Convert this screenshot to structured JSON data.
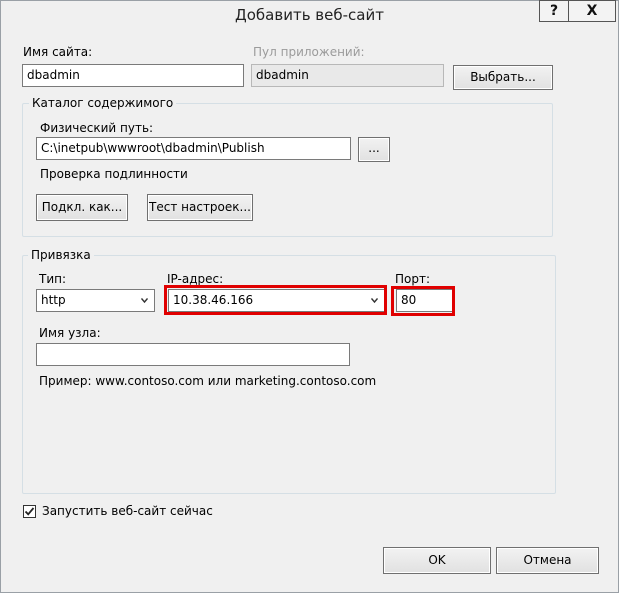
{
  "window": {
    "title": "Добавить веб-сайт",
    "help_label": "?",
    "close_label": "X"
  },
  "site": {
    "name_label": "Имя сайта:",
    "name_value": "dbadmin"
  },
  "app_pool": {
    "label": "Пул приложений:",
    "value": "dbadmin",
    "select_button": "Выбрать..."
  },
  "content": {
    "group_title": "Каталог содержимого",
    "path_label": "Физический путь:",
    "path_value": "C:\\inetpub\\wwwroot\\dbadmin\\Publish",
    "browse_button": "...",
    "auth_label": "Проверка подлинности",
    "connect_as_button": "Подкл. как...",
    "test_settings_button": "Тест настроек..."
  },
  "binding": {
    "group_title": "Привязка",
    "type_label": "Тип:",
    "type_value": "http",
    "ip_label": "IP-адрес:",
    "ip_value": "10.38.46.166",
    "port_label": "Порт:",
    "port_value": "80",
    "host_label": "Имя узла:",
    "host_value": "",
    "example_text": "Пример: www.contoso.com или marketing.contoso.com"
  },
  "start_site": {
    "label": "Запустить веб-сайт сейчас",
    "checked": true
  },
  "footer": {
    "ok_label": "OK",
    "cancel_label": "Отмена"
  },
  "colors": {
    "highlight": "#e00000",
    "group_border": "#d5dfe5",
    "window_bg": "#f0f0f0"
  },
  "icons": {
    "dropdown": "chevron-down-icon",
    "checkbox": "checkmark-icon"
  }
}
